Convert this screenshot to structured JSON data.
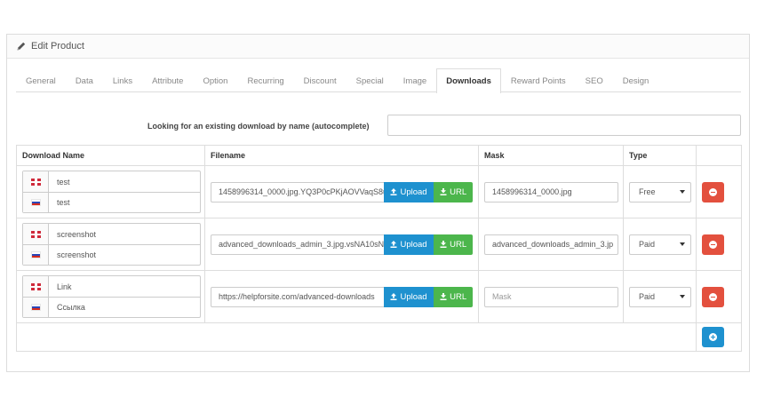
{
  "panel": {
    "title": "Edit Product",
    "icon": "pencil-icon"
  },
  "tabs": [
    {
      "label": "General",
      "active": false
    },
    {
      "label": "Data",
      "active": false
    },
    {
      "label": "Links",
      "active": false
    },
    {
      "label": "Attribute",
      "active": false
    },
    {
      "label": "Option",
      "active": false
    },
    {
      "label": "Recurring",
      "active": false
    },
    {
      "label": "Discount",
      "active": false
    },
    {
      "label": "Special",
      "active": false
    },
    {
      "label": "Image",
      "active": false
    },
    {
      "label": "Downloads",
      "active": true
    },
    {
      "label": "Reward Points",
      "active": false
    },
    {
      "label": "SEO",
      "active": false
    },
    {
      "label": "Design",
      "active": false
    }
  ],
  "lookup": {
    "label": "Looking for an existing download by name (autocomplete)",
    "value": ""
  },
  "table": {
    "headers": {
      "name": "Download Name",
      "filename": "Filename",
      "mask": "Mask",
      "type": "Type"
    },
    "upload_label": "Upload",
    "url_label": "URL",
    "mask_placeholder": "Mask",
    "rows": [
      {
        "name_en": "test",
        "name_ru": "test",
        "filename": "1458996314_0000.jpg.YQ3P0cPKjAOVVaqS8u",
        "mask": "1458996314_0000.jpg",
        "type": "Free"
      },
      {
        "name_en": "screenshot",
        "name_ru": "screenshot",
        "filename": "advanced_downloads_admin_3.jpg.vsNA10sN",
        "mask": "advanced_downloads_admin_3.jp",
        "type": "Paid"
      },
      {
        "name_en": "Link",
        "name_ru": "Ссылка",
        "filename": "https://helpforsite.com/advanced-downloads",
        "mask": "",
        "type": "Paid"
      }
    ]
  },
  "colors": {
    "upload": "#1e91cf",
    "url": "#4cb64c",
    "remove": "#e3503e",
    "add": "#1e91cf"
  }
}
